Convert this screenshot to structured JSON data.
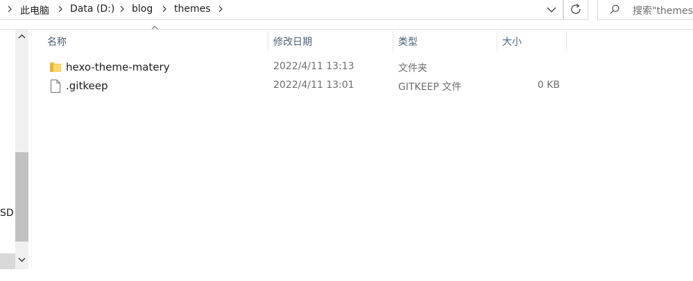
{
  "address_bar": {
    "crumbs": [
      "此电脑",
      "Data (D:)",
      "blog",
      "themes"
    ]
  },
  "search": {
    "placeholder": "搜索\"themes\""
  },
  "nav": {
    "partial_label": "SD ("
  },
  "columns": {
    "name": "名称",
    "date": "修改日期",
    "type": "类型",
    "size": "大小"
  },
  "files": [
    {
      "name": "hexo-theme-matery",
      "date": "2022/4/11 13:13",
      "type": "文件夹",
      "size": "",
      "icon": "folder-icon"
    },
    {
      "name": ".gitkeep",
      "date": "2022/4/11 13:01",
      "type": "GITKEEP 文件",
      "size": "0 KB",
      "icon": "file-icon"
    }
  ],
  "colors": {
    "header_text": "#4c607a",
    "folder": "#f4c24d",
    "scroll_thumb": "#c1c1c1"
  }
}
